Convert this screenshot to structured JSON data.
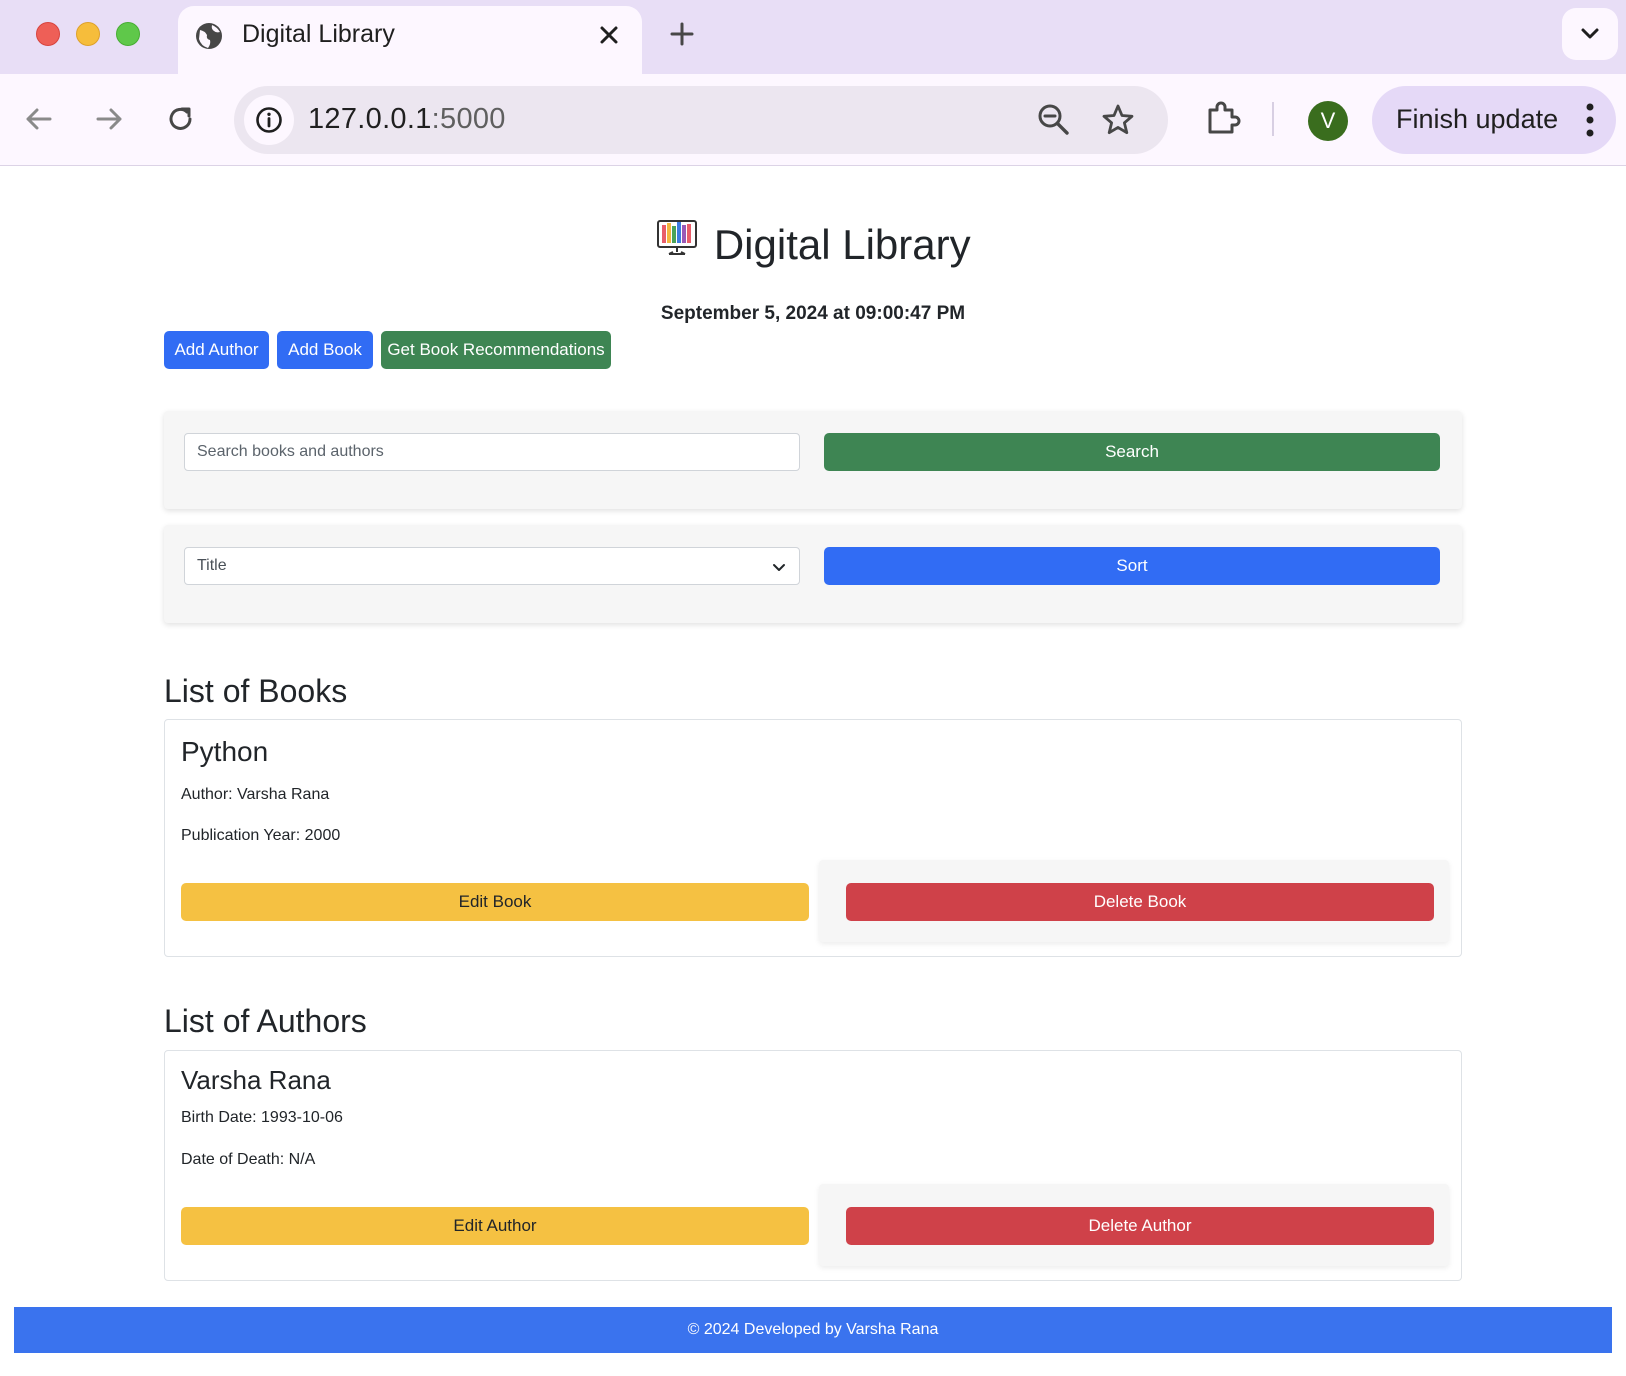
{
  "browser": {
    "tab_title": "Digital Library",
    "url_host": "127.0.0.1",
    "url_port": ":5000",
    "avatar_letter": "V",
    "finish_update_label": "Finish update"
  },
  "header": {
    "title": "Digital Library",
    "datetime": "September 5, 2024 at 09:00:47 PM"
  },
  "actions": {
    "add_author": "Add Author",
    "add_book": "Add Book",
    "recommendations": "Get Book Recommendations"
  },
  "search": {
    "placeholder": "Search books and authors",
    "button": "Search"
  },
  "sort": {
    "selected": "Title",
    "button": "Sort"
  },
  "books": {
    "heading": "List of Books",
    "items": [
      {
        "title": "Python",
        "author": "Author: Varsha Rana",
        "year": "Publication Year: 2000",
        "edit": "Edit Book",
        "delete": "Delete Book"
      }
    ]
  },
  "authors": {
    "heading": "List of Authors",
    "items": [
      {
        "name": "Varsha Rana",
        "birth": "Birth Date: 1993-10-06",
        "death": "Date of Death: N/A",
        "edit": "Edit Author",
        "delete": "Delete Author"
      }
    ]
  },
  "footer": {
    "text": "© 2024 Developed by Varsha Rana"
  },
  "colors": {
    "primary": "#316cf4",
    "success": "#3e8553",
    "warning": "#f5c142",
    "danger": "#cf4149",
    "footer": "#3a73ee"
  }
}
